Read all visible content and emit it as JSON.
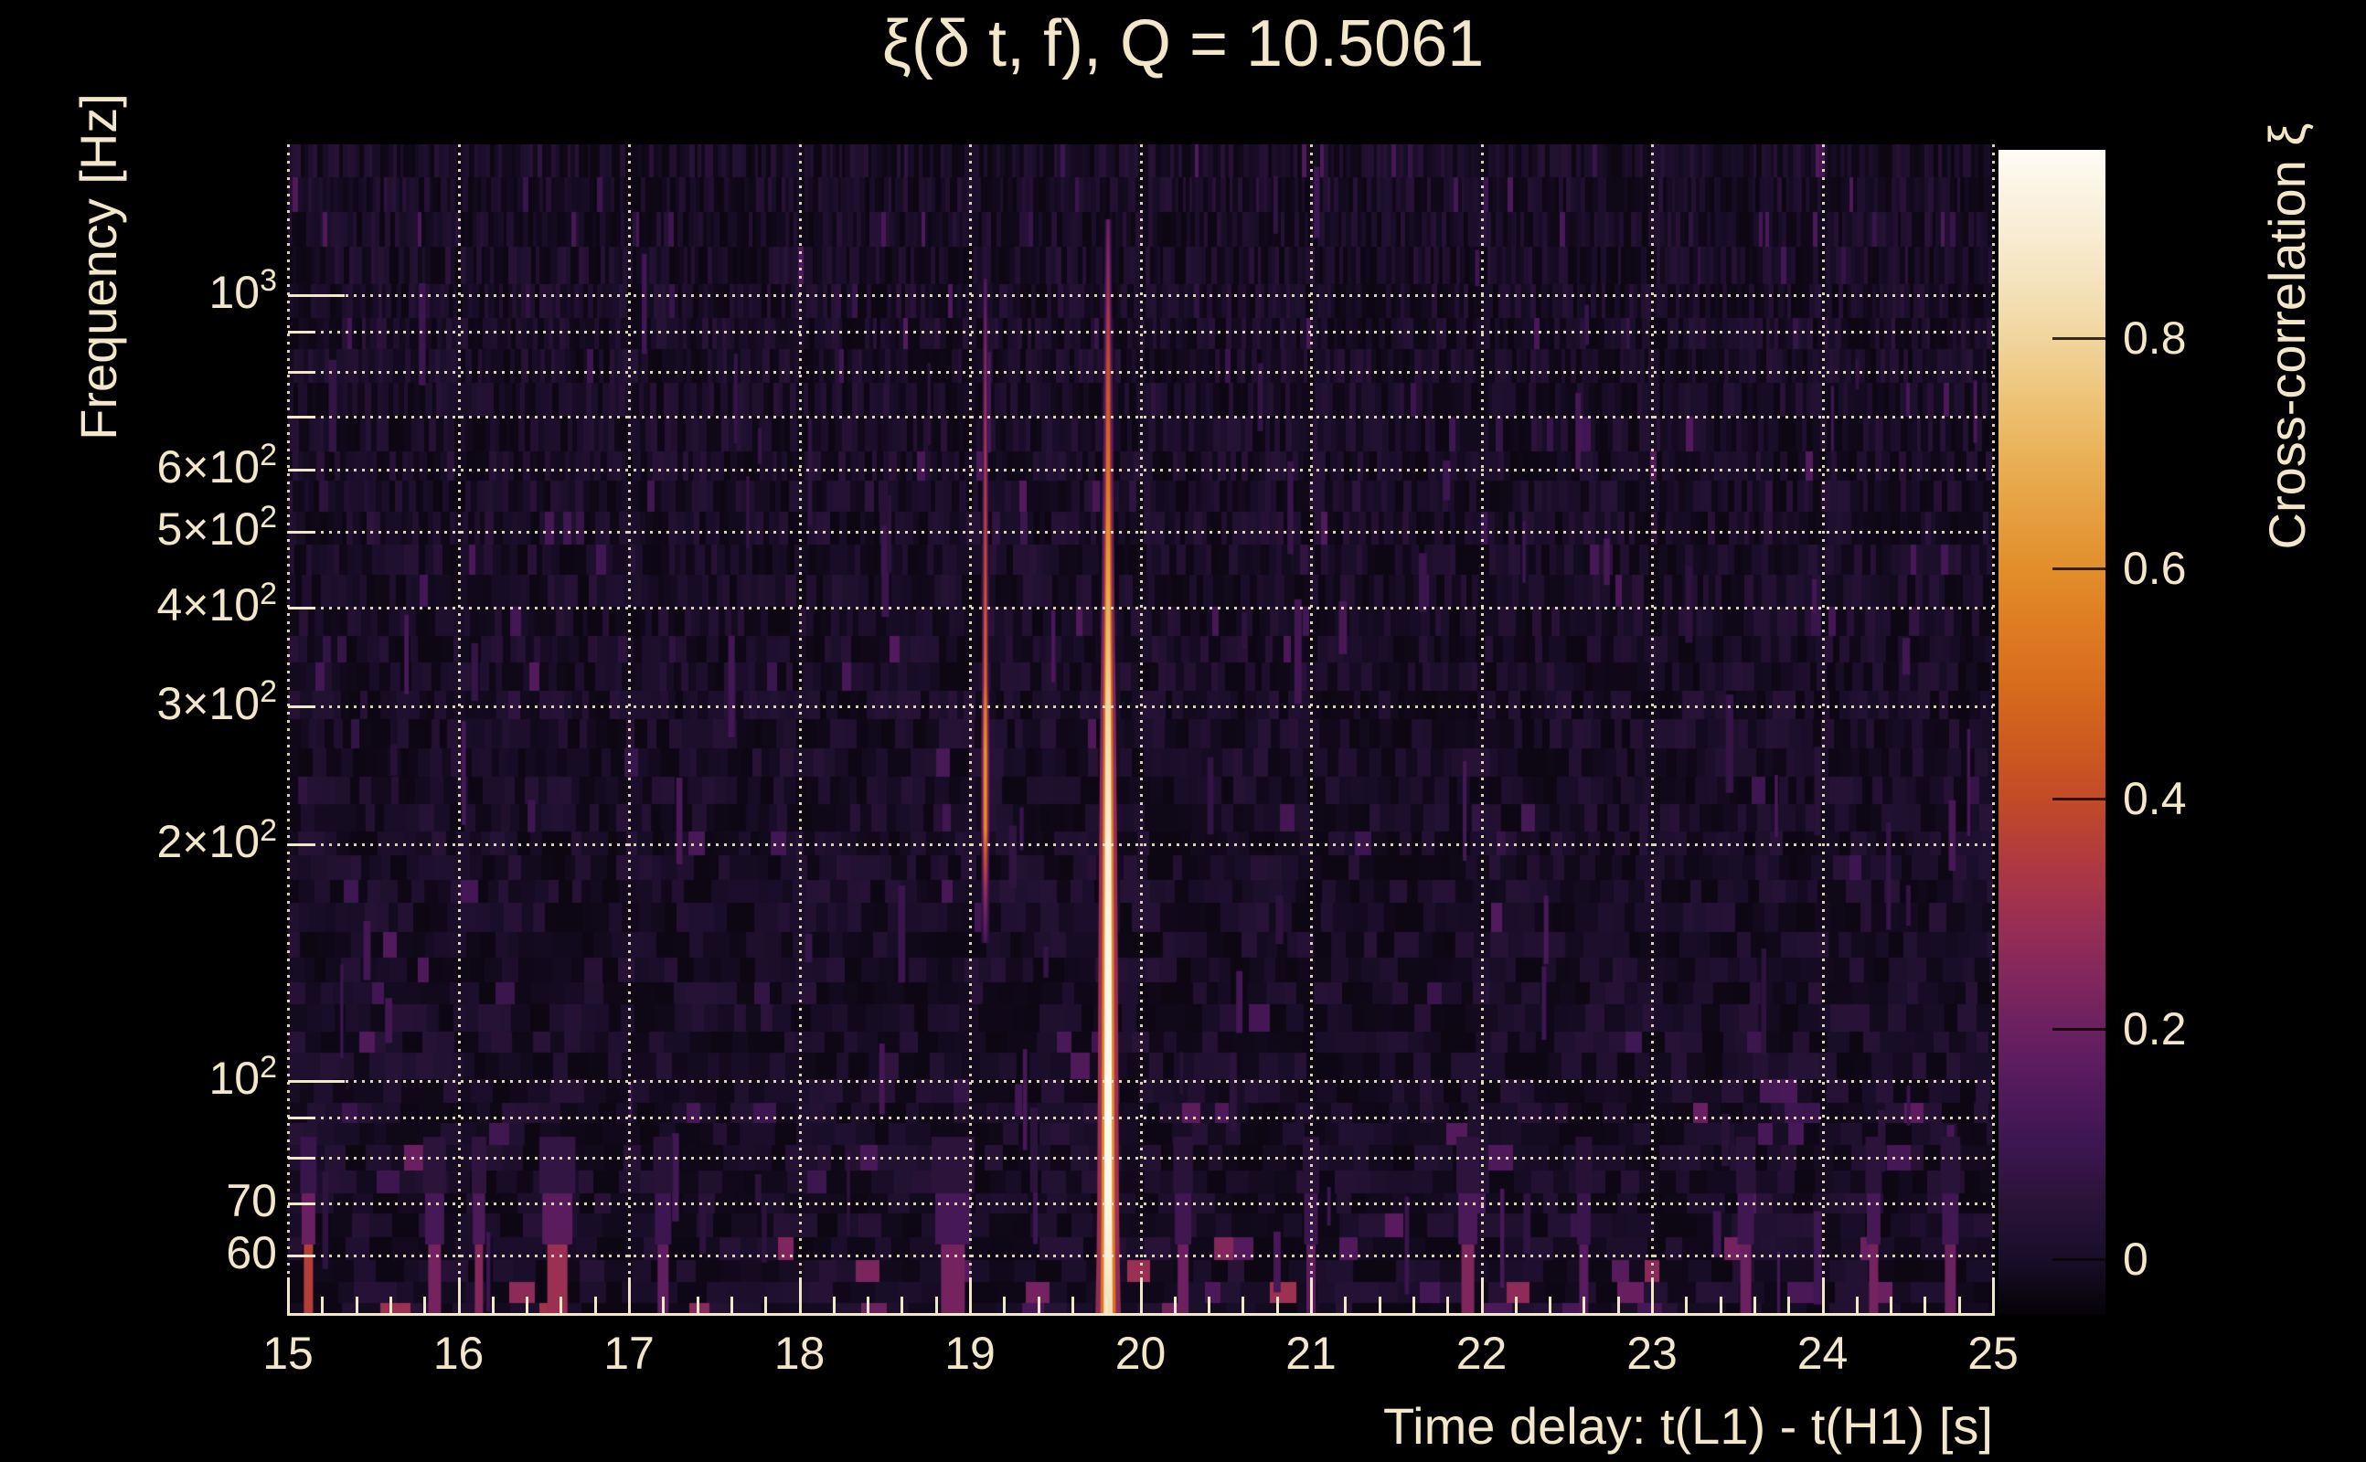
{
  "figure": {
    "background_color": "#000000",
    "foreground_color": "#f2e7c9",
    "grid_color": "#efe3c4"
  },
  "chart_data": {
    "type": "heatmap",
    "title": "ξ(δ t, f), Q = 10.5061",
    "q_value": 10.5061,
    "xlabel": "Time delay: t(L1) - t(H1) [s]",
    "ylabel": "Frequency [Hz]",
    "x_range_s": [
      15,
      25
    ],
    "x_major_ticks": [
      15,
      16,
      17,
      18,
      19,
      20,
      21,
      22,
      23,
      24,
      25
    ],
    "x_tick_labels": [
      "15",
      "16",
      "17",
      "18",
      "19",
      "20",
      "21",
      "22",
      "23",
      "24",
      "25"
    ],
    "x_minor_step_s": 0.2,
    "y_scale": "log",
    "y_range_hz": [
      50.3,
      1556
    ],
    "y_ticks": [
      {
        "f": 1000,
        "pre": "10",
        "sup": "3"
      },
      {
        "f": 600,
        "pre": "6×10",
        "sup": "2"
      },
      {
        "f": 500,
        "pre": "5×10",
        "sup": "2"
      },
      {
        "f": 400,
        "pre": "4×10",
        "sup": "2"
      },
      {
        "f": 300,
        "pre": "3×10",
        "sup": "2"
      },
      {
        "f": 200,
        "pre": "2×10",
        "sup": "2"
      },
      {
        "f": 100,
        "pre": "10",
        "sup": "2"
      },
      {
        "f": 70,
        "pre": "70",
        "sup": ""
      },
      {
        "f": 60,
        "pre": "60",
        "sup": ""
      }
    ],
    "y_minor_ticks_hz": [
      60,
      70,
      80,
      90,
      100,
      200,
      300,
      400,
      500,
      600,
      700,
      800,
      900,
      1000
    ],
    "grid_x_s": [
      15,
      16,
      17,
      18,
      19,
      20,
      21,
      22,
      23,
      24,
      25
    ],
    "grid_y_hz": [
      60,
      70,
      80,
      90,
      100,
      200,
      300,
      400,
      500,
      600,
      700,
      800,
      900,
      1000
    ],
    "grid": "dotted",
    "colorbar": {
      "label": "Cross-correlation ξ",
      "tick_values": [
        0,
        0.2,
        0.4,
        0.6,
        0.8
      ],
      "tick_labels": [
        "0",
        "0.2",
        "0.4",
        "0.6",
        "0.8"
      ],
      "range": [
        -0.048,
        0.963
      ],
      "gradient_stops": [
        [
          -0.048,
          "#050207"
        ],
        [
          0.0,
          "#190e29"
        ],
        [
          0.05,
          "#2a1338"
        ],
        [
          0.1,
          "#3c1650"
        ],
        [
          0.15,
          "#531a5c"
        ],
        [
          0.2,
          "#6b2060"
        ],
        [
          0.25,
          "#84285c"
        ],
        [
          0.3,
          "#9c3052"
        ],
        [
          0.35,
          "#b13b3e"
        ],
        [
          0.4,
          "#c34b27"
        ],
        [
          0.45,
          "#ce5b1f"
        ],
        [
          0.5,
          "#d76c1e"
        ],
        [
          0.55,
          "#de7c22"
        ],
        [
          0.6,
          "#e28e2b"
        ],
        [
          0.65,
          "#e6a041"
        ],
        [
          0.7,
          "#eab259"
        ],
        [
          0.75,
          "#eec47a"
        ],
        [
          0.8,
          "#f1d59e"
        ],
        [
          0.85,
          "#f5e3bf"
        ],
        [
          0.9,
          "#f9eed7"
        ],
        [
          0.963,
          "#fefcf4"
        ]
      ]
    },
    "features": [
      {
        "name": "primary-correlation-ridge",
        "t_delay_s": 19.81,
        "f_span_hz": [
          50,
          1250
        ],
        "peak_xi": 0.95,
        "profile": [
          [
            1250,
            0.2,
            2.5
          ],
          [
            1000,
            0.3,
            3.0
          ],
          [
            800,
            0.42,
            3.5
          ],
          [
            600,
            0.52,
            4.0
          ],
          [
            500,
            0.6,
            4.5
          ],
          [
            400,
            0.7,
            5.0
          ],
          [
            300,
            0.8,
            6.0
          ],
          [
            200,
            0.9,
            7.0
          ],
          [
            150,
            0.93,
            7.5
          ],
          [
            100,
            0.95,
            8.0
          ],
          [
            70,
            0.94,
            8.5
          ],
          [
            60,
            0.9,
            9.0
          ],
          [
            50,
            0.82,
            10.0
          ]
        ]
      },
      {
        "name": "secondary-correlation-ridge",
        "t_delay_s": 19.09,
        "f_span_hz": [
          150,
          1050
        ],
        "peak_xi": 0.62,
        "profile": [
          [
            1050,
            0.15,
            2.0
          ],
          [
            900,
            0.22,
            2.0
          ],
          [
            700,
            0.3,
            2.2
          ],
          [
            500,
            0.38,
            2.4
          ],
          [
            320,
            0.5,
            2.6
          ],
          [
            300,
            0.55,
            3.0
          ],
          [
            260,
            0.62,
            3.2
          ],
          [
            210,
            0.6,
            3.2
          ],
          [
            195,
            0.45,
            3.0
          ],
          [
            170,
            0.25,
            3.2
          ],
          [
            150,
            0.12,
            3.2
          ]
        ]
      }
    ],
    "low_band_blobs": [
      {
        "t": 15.12,
        "xi": 0.36,
        "w": 10
      },
      {
        "t": 15.86,
        "xi": 0.22,
        "w": 14
      },
      {
        "t": 16.12,
        "xi": 0.25,
        "w": 9
      },
      {
        "t": 16.58,
        "xi": 0.3,
        "w": 22
      },
      {
        "t": 17.2,
        "xi": 0.18,
        "w": 12
      },
      {
        "t": 18.9,
        "xi": 0.22,
        "w": 26
      },
      {
        "t": 20.25,
        "xi": 0.2,
        "w": 12
      },
      {
        "t": 21.0,
        "xi": 0.17,
        "w": 10
      },
      {
        "t": 21.92,
        "xi": 0.24,
        "w": 14
      },
      {
        "t": 22.6,
        "xi": 0.16,
        "w": 10
      },
      {
        "t": 23.55,
        "xi": 0.2,
        "w": 12
      },
      {
        "t": 24.3,
        "xi": 0.22,
        "w": 10
      },
      {
        "t": 24.75,
        "xi": 0.2,
        "w": 12
      }
    ],
    "noise_floor_xi_range": [
      -0.05,
      0.15
    ]
  }
}
